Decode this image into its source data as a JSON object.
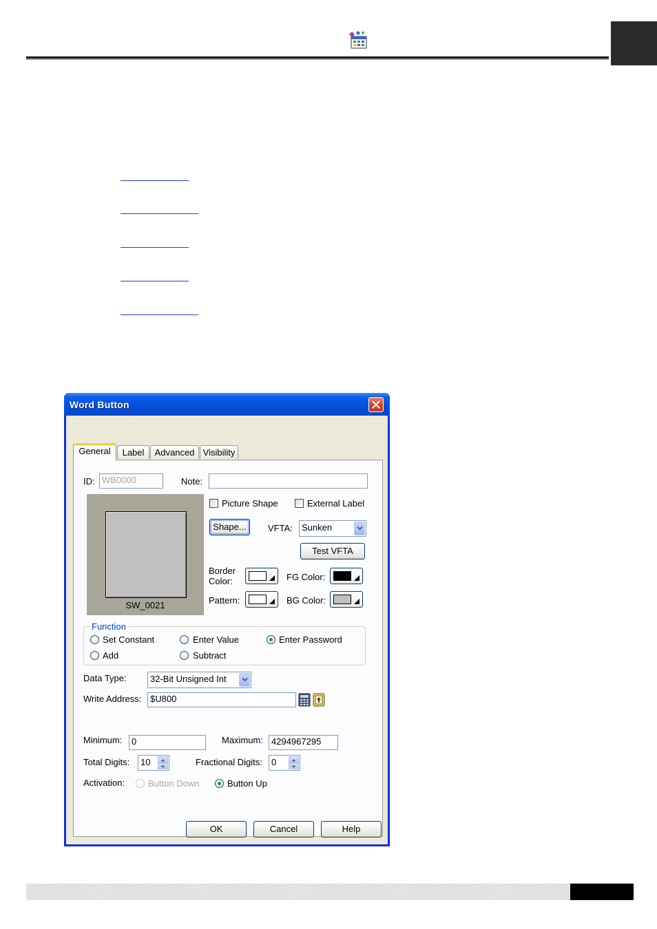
{
  "colors": {
    "titlebar": "#0a5ee8",
    "dialog_face": "#ece9d8",
    "group_legend": "#0046d5",
    "radio_selected": "#21a121",
    "close_button": "#d4412a"
  },
  "header": {
    "icon": "app-icon"
  },
  "dialog": {
    "title": "Word Button",
    "close_icon": "close-icon",
    "tabs": [
      {
        "label": "General",
        "active": true
      },
      {
        "label": "Label",
        "active": false
      },
      {
        "label": "Advanced",
        "active": false
      },
      {
        "label": "Visibility",
        "active": false
      }
    ],
    "general": {
      "id_label": "ID:",
      "id_value": "WB0000",
      "note_label": "Note:",
      "note_value": "",
      "preview_caption": "SW_0021",
      "picture_shape_label": "Picture Shape",
      "picture_shape_checked": false,
      "external_label_label": "External Label",
      "external_label_checked": false,
      "shape_button": "Shape...",
      "vfta_label": "VFTA:",
      "vfta_value": "Sunken",
      "test_vfta_button": "Test VFTA",
      "border_color_label_1": "Border",
      "border_color_label_2": "Color:",
      "border_color": "#ffffff",
      "fg_color_label": "FG Color:",
      "fg_color": "#000000",
      "pattern_label": "Pattern:",
      "pattern_color": "#ffffff",
      "bg_color_label": "BG Color:",
      "bg_color": "#c0c0c0",
      "function": {
        "legend": "Function",
        "options": [
          {
            "label": "Set Constant",
            "selected": false
          },
          {
            "label": "Enter Value",
            "selected": false
          },
          {
            "label": "Enter Password",
            "selected": true
          },
          {
            "label": "Add",
            "selected": false
          },
          {
            "label": "Subtract",
            "selected": false
          }
        ]
      },
      "data_type_label": "Data Type:",
      "data_type_value": "32-Bit Unsigned Int",
      "write_address_label": "Write Address:",
      "write_address_value": "$U800",
      "minimum_label": "Minimum:",
      "minimum_value": "0",
      "maximum_label": "Maximum:",
      "maximum_value": "4294967295",
      "total_digits_label": "Total Digits:",
      "total_digits_value": "10",
      "fractional_digits_label": "Fractional Digits:",
      "fractional_digits_value": "0",
      "activation_label": "Activation:",
      "activation_options": [
        {
          "label": "Button Down",
          "selected": false,
          "enabled": false
        },
        {
          "label": "Button Up",
          "selected": true,
          "enabled": true
        }
      ]
    },
    "buttons": {
      "ok": "OK",
      "cancel": "Cancel",
      "help": "Help"
    }
  }
}
